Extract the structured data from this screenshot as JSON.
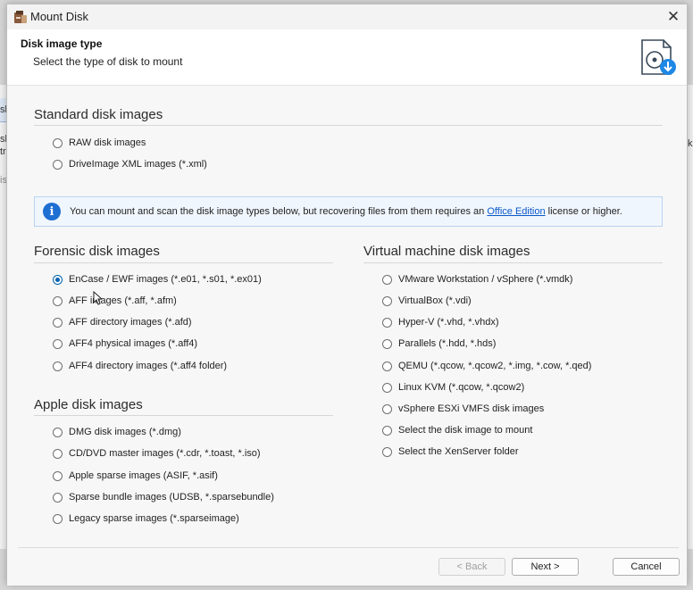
{
  "window": {
    "title": "Mount Disk",
    "close_label": "✕"
  },
  "header": {
    "title": "Disk image type",
    "subtitle": "Select the type of disk to mount"
  },
  "standard": {
    "title": "Standard disk images",
    "options": [
      "RAW disk images",
      "DriveImage XML images (*.xml)"
    ]
  },
  "info": {
    "text_before": "You can mount and scan the disk image types below, but recovering files from them requires an ",
    "link": "Office Edition",
    "text_after": " license or higher."
  },
  "forensic": {
    "title": "Forensic disk images",
    "options": [
      "EnCase / EWF images (*.e01, *.s01, *.ex01)",
      "AFF images (*.aff, *.afm)",
      "AFF directory images (*.afd)",
      "AFF4 physical images (*.aff4)",
      "AFF4 directory images (*.aff4 folder)"
    ],
    "selected_index": 0
  },
  "apple": {
    "title": "Apple disk images",
    "options": [
      "DMG disk images (*.dmg)",
      "CD/DVD master images (*.cdr, *.toast, *.iso)",
      "Apple sparse images (ASIF, *.asif)",
      "Sparse bundle images (UDSB, *.sparsebundle)",
      "Legacy sparse images (*.sparseimage)"
    ]
  },
  "vm": {
    "title": "Virtual machine disk images",
    "options": [
      "VMware Workstation / vSphere (*.vmdk)",
      "VirtualBox (*.vdi)",
      "Hyper-V (*.vhd, *.vhdx)",
      "Parallels (*.hdd, *.hds)",
      "QEMU (*.qcow, *.qcow2, *.img, *.cow, *.qed)",
      "Linux KVM (*.qcow, *.qcow2)",
      "vSphere ESXi VMFS disk images",
      "Select the disk image to mount",
      "Select the XenServer folder"
    ]
  },
  "buttons": {
    "back": "< Back",
    "next": "Next >",
    "cancel": "Cancel"
  },
  "behind": {
    "letters": [
      "sk",
      "sk",
      "tr",
      "is",
      "k"
    ]
  },
  "colors": {
    "accent": "#0063b1",
    "info_bg": "#f0f6fd",
    "link": "#0a58c9"
  }
}
